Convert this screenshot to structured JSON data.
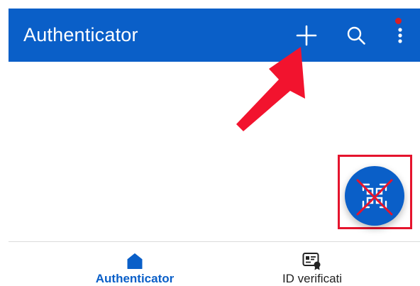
{
  "app_bar": {
    "title": "Authenticator",
    "add_icon": "plus-icon",
    "search_icon": "search-icon",
    "more_icon": "more-vertical-icon"
  },
  "fab": {
    "icon": "qr-scan-icon"
  },
  "bottom_nav": {
    "items": [
      {
        "label": "Authenticator",
        "icon": "home-icon",
        "active": true
      },
      {
        "label": "ID verificati",
        "icon": "id-card-icon",
        "active": false
      }
    ]
  },
  "colors": {
    "primary": "#0a5fc8",
    "annotation_red": "#e5142d",
    "badge_red": "#d61f26"
  }
}
